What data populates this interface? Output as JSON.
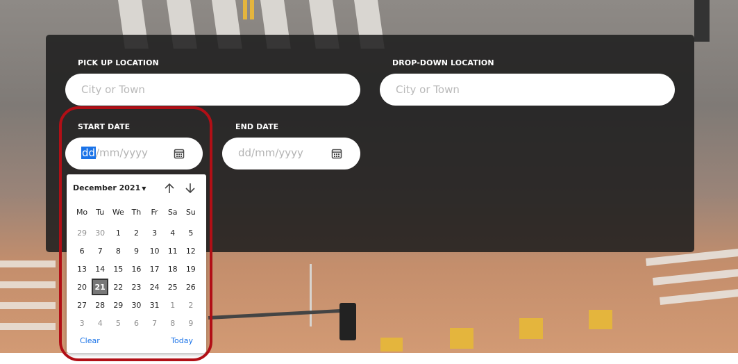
{
  "form": {
    "pickup": {
      "label": "PICK UP LOCATION",
      "placeholder": "City or Town"
    },
    "dropoff": {
      "label": "DROP-DOWN LOCATION",
      "placeholder": "City or Town"
    },
    "start_date": {
      "label": "START DATE",
      "segment_dd": "dd",
      "rest": "/mm/yyyy",
      "active_segment": "dd"
    },
    "end_date": {
      "label": "END DATE",
      "value": "dd/mm/yyyy"
    }
  },
  "calendar": {
    "month_label": "December 2021",
    "weekdays": [
      "Mo",
      "Tu",
      "We",
      "Th",
      "Fr",
      "Sa",
      "Su"
    ],
    "weeks": [
      [
        {
          "d": "29",
          "o": true
        },
        {
          "d": "30",
          "o": true
        },
        {
          "d": "1"
        },
        {
          "d": "2"
        },
        {
          "d": "3"
        },
        {
          "d": "4"
        },
        {
          "d": "5"
        }
      ],
      [
        {
          "d": "6"
        },
        {
          "d": "7"
        },
        {
          "d": "8"
        },
        {
          "d": "9"
        },
        {
          "d": "10"
        },
        {
          "d": "11"
        },
        {
          "d": "12"
        }
      ],
      [
        {
          "d": "13"
        },
        {
          "d": "14"
        },
        {
          "d": "15"
        },
        {
          "d": "16"
        },
        {
          "d": "17"
        },
        {
          "d": "18"
        },
        {
          "d": "19"
        }
      ],
      [
        {
          "d": "20"
        },
        {
          "d": "21",
          "s": true
        },
        {
          "d": "22"
        },
        {
          "d": "23"
        },
        {
          "d": "24"
        },
        {
          "d": "25"
        },
        {
          "d": "26"
        }
      ],
      [
        {
          "d": "27"
        },
        {
          "d": "28"
        },
        {
          "d": "29"
        },
        {
          "d": "30"
        },
        {
          "d": "31"
        },
        {
          "d": "1",
          "o": true
        },
        {
          "d": "2",
          "o": true
        }
      ],
      [
        {
          "d": "3",
          "o": true
        },
        {
          "d": "4",
          "o": true
        },
        {
          "d": "5",
          "o": true
        },
        {
          "d": "6",
          "o": true
        },
        {
          "d": "7",
          "o": true
        },
        {
          "d": "8",
          "o": true
        },
        {
          "d": "9",
          "o": true
        }
      ]
    ],
    "clear_label": "Clear",
    "today_label": "Today"
  },
  "colors": {
    "panel": "#1c1c1c",
    "highlight": "#b10f16",
    "accent": "#1a73e8",
    "selected_day": "#777777"
  },
  "icons": {
    "calendar": "calendar-icon",
    "prev": "arrow-up-icon",
    "next": "arrow-down-icon"
  }
}
